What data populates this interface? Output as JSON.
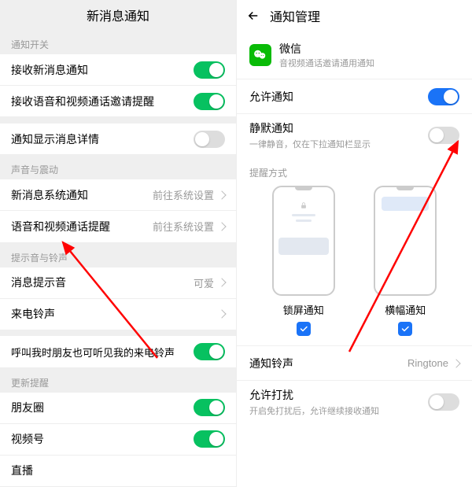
{
  "left": {
    "title": "新消息通知",
    "sec_switch": "通知开关",
    "receive_new": "接收新消息通知",
    "receive_av": "接收语音和视频通话邀请提醒",
    "show_detail": "通知显示消息详情",
    "sec_sound": "声音与震动",
    "sys_notify": "新消息系统通知",
    "sys_value": "前往系统设置",
    "av_remind": "语音和视频通话提醒",
    "sec_tone": "提示音与铃声",
    "msg_tone": "消息提示音",
    "msg_tone_value": "可爱",
    "ringtone": "来电铃声",
    "call_visible": "呼叫我时朋友也可听见我的来电铃声",
    "sec_update": "更新提醒",
    "moments": "朋友圈",
    "channels": "视频号",
    "live": "直播"
  },
  "right": {
    "title": "通知管理",
    "app_name": "微信",
    "app_sub": "音视频通话邀请通用通知",
    "allow": "允许通知",
    "silent_title": "静默通知",
    "silent_sub": "一律静音，仅在下拉通知栏显示",
    "mode_head": "提醒方式",
    "mock1": "锁屏通知",
    "mock2": "横幅通知",
    "ringtone_label": "通知铃声",
    "ringtone_value": "Ringtone",
    "dnd_title": "允许打扰",
    "dnd_sub": "开启免打扰后，允许继续接收通知"
  },
  "colors": {
    "green": "#07c160",
    "blue": "#1a73f7",
    "red": "#ff0000"
  }
}
